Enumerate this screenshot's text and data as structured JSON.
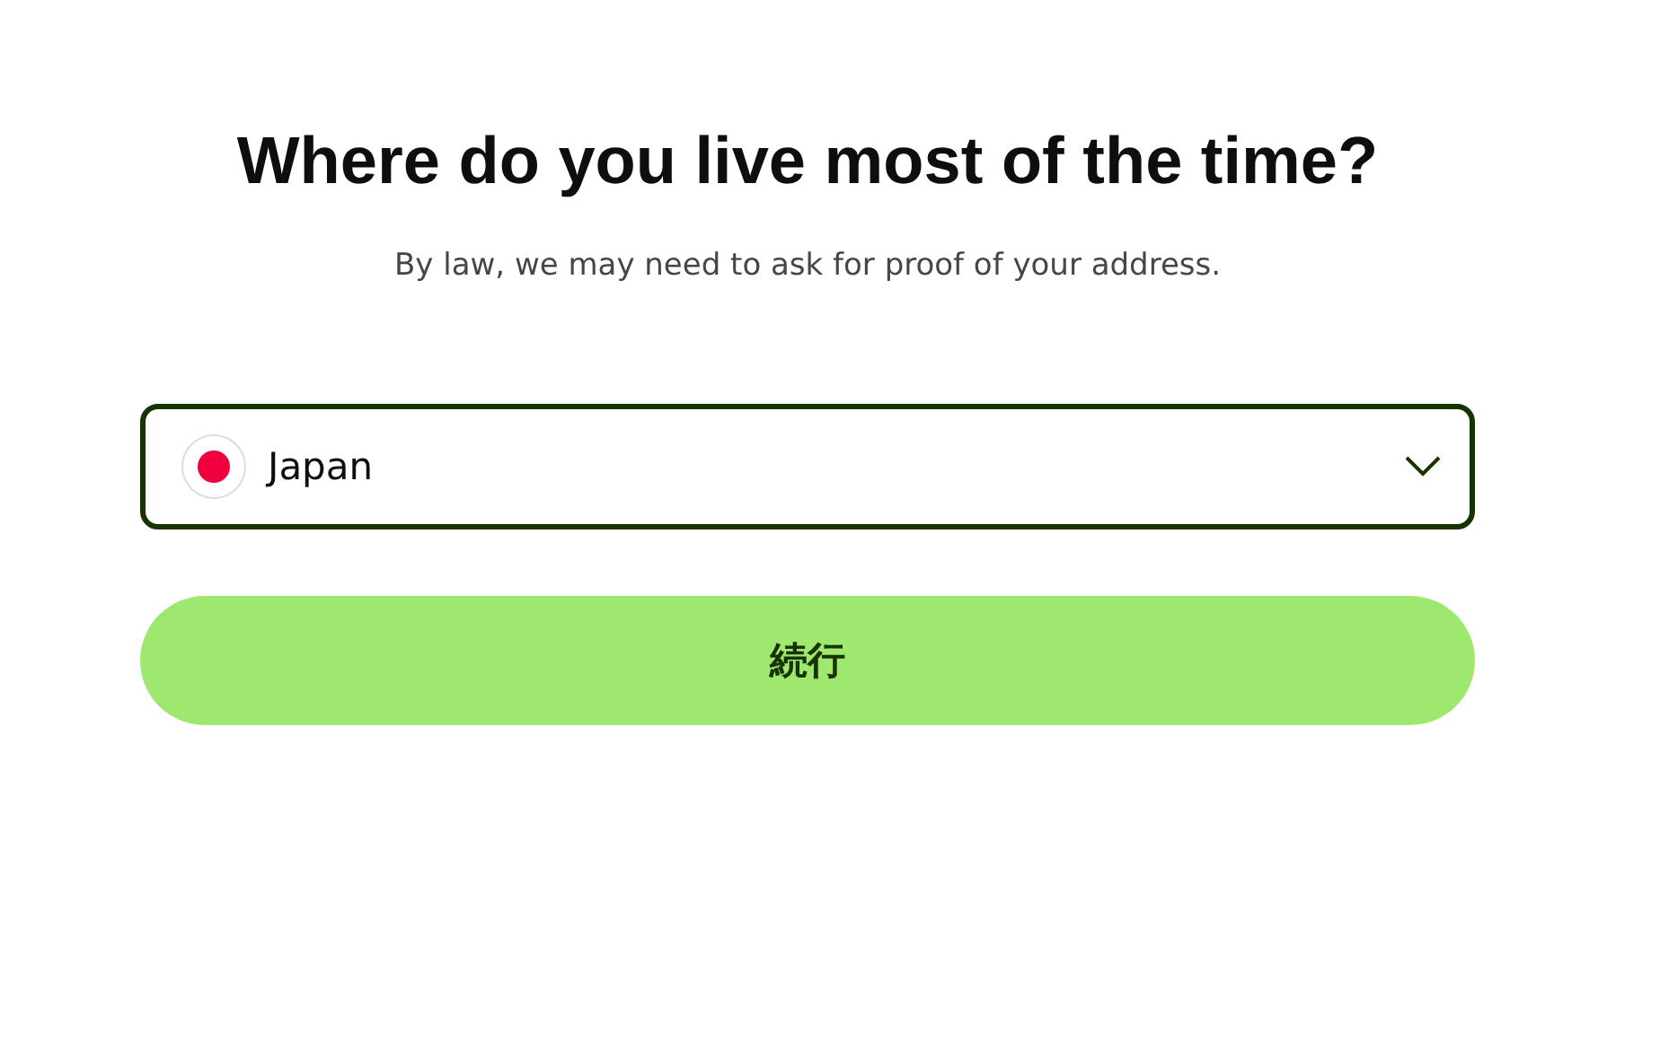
{
  "heading": "Where do you live most of the time?",
  "subheading": "By law, we may need to ask for proof of your address.",
  "country_select": {
    "value": "Japan",
    "focused": true
  },
  "continue_button": {
    "label": "続行"
  }
}
